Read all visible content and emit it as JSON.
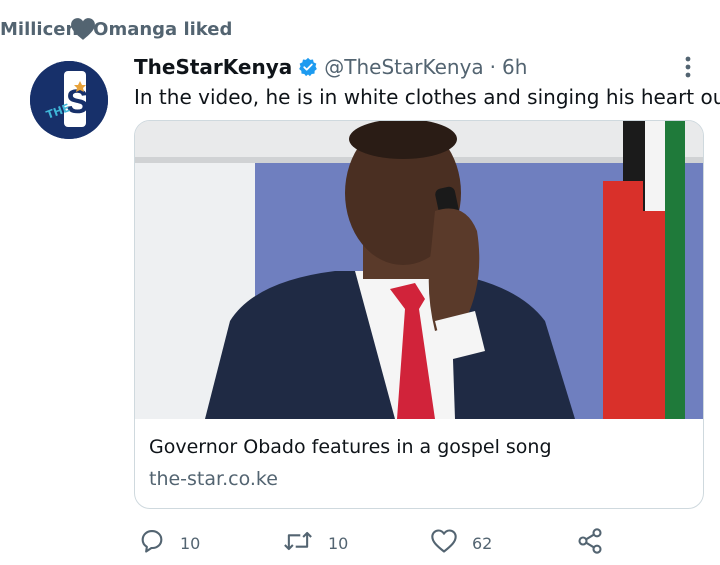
{
  "social_context": {
    "text": "Millicent Omanga liked",
    "icon": "heart-icon"
  },
  "tweet": {
    "avatar_text": "THE",
    "name": "TheStarKenya",
    "handle": "@TheStarKenya",
    "separator": "·",
    "time": "6h",
    "text": "In the video, he is in white clothes and singing his heart out."
  },
  "card": {
    "title": "Governor Obado features in a gospel song",
    "domain": "the-star.co.ke"
  },
  "actions": {
    "reply_count": "10",
    "retweet_count": "10",
    "like_count": "62"
  },
  "colors": {
    "secondary_text": "#536471",
    "verified_blue": "#1d9bf0",
    "avatar_bg": "#17306a"
  }
}
